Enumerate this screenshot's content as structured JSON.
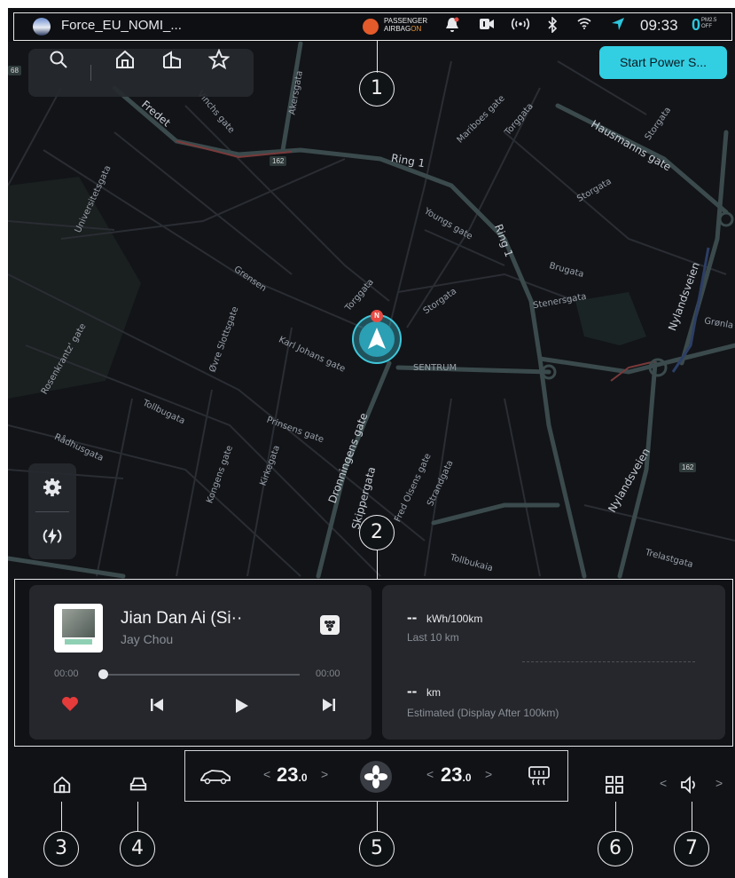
{
  "status_bar": {
    "profile_name": "Force_EU_NOMI_...",
    "airbag_line1": "PASSENGER",
    "airbag_line2": "AIRBAG",
    "airbag_state": "ON",
    "time": "09:33",
    "pm_value": "0",
    "pm_label_line1": "PM2.5",
    "pm_label_line2": "OFF"
  },
  "map": {
    "start_power_button": "Start Power S...",
    "north_label": "N",
    "highway_labels": [
      "162",
      "162",
      "68"
    ],
    "streets": [
      "Akersgata",
      "Ring 1",
      "Mariboes gate",
      "Torggata",
      "Hausmanns gate",
      "Storgata",
      "Universitetsgata",
      "Youngs gate",
      "Ring 1",
      "Brugata",
      "Grensen",
      "Torggata",
      "Storgata",
      "Stenersgata",
      "Nylandsveien",
      "Grønla",
      "Rosenkrantz' gate",
      "Øvre Slottsgate",
      "Karl Johans gate",
      "SENTRUM",
      "Tollbugata",
      "Prinsens gate",
      "Rådhusgata",
      "Kirkegata",
      "Kongens gate",
      "Dronningens gate",
      "Skippergata",
      "Fred Olsens gate",
      "Strandgata",
      "Nylandsveien",
      "Tollbukaia",
      "Trelastgata",
      "Vinchs gate",
      "Fredet",
      "Storgata"
    ]
  },
  "media": {
    "song_title": "Jian Dan Ai (Si··",
    "artist": "Jay Chou",
    "elapsed": "00:00",
    "duration": "00:00",
    "progress_fraction": 0
  },
  "energy": {
    "consumption_value": "--",
    "consumption_unit": "kWh/100km",
    "consumption_label": "Last 10 km",
    "range_value": "--",
    "range_unit": "km",
    "range_label": "Estimated (Display After 100km)"
  },
  "climate": {
    "left_temp": "23",
    "left_temp_decimal": ".0",
    "right_temp": "23",
    "right_temp_decimal": ".0"
  },
  "annotations": [
    "1",
    "2",
    "3",
    "4",
    "5",
    "6",
    "7"
  ]
}
